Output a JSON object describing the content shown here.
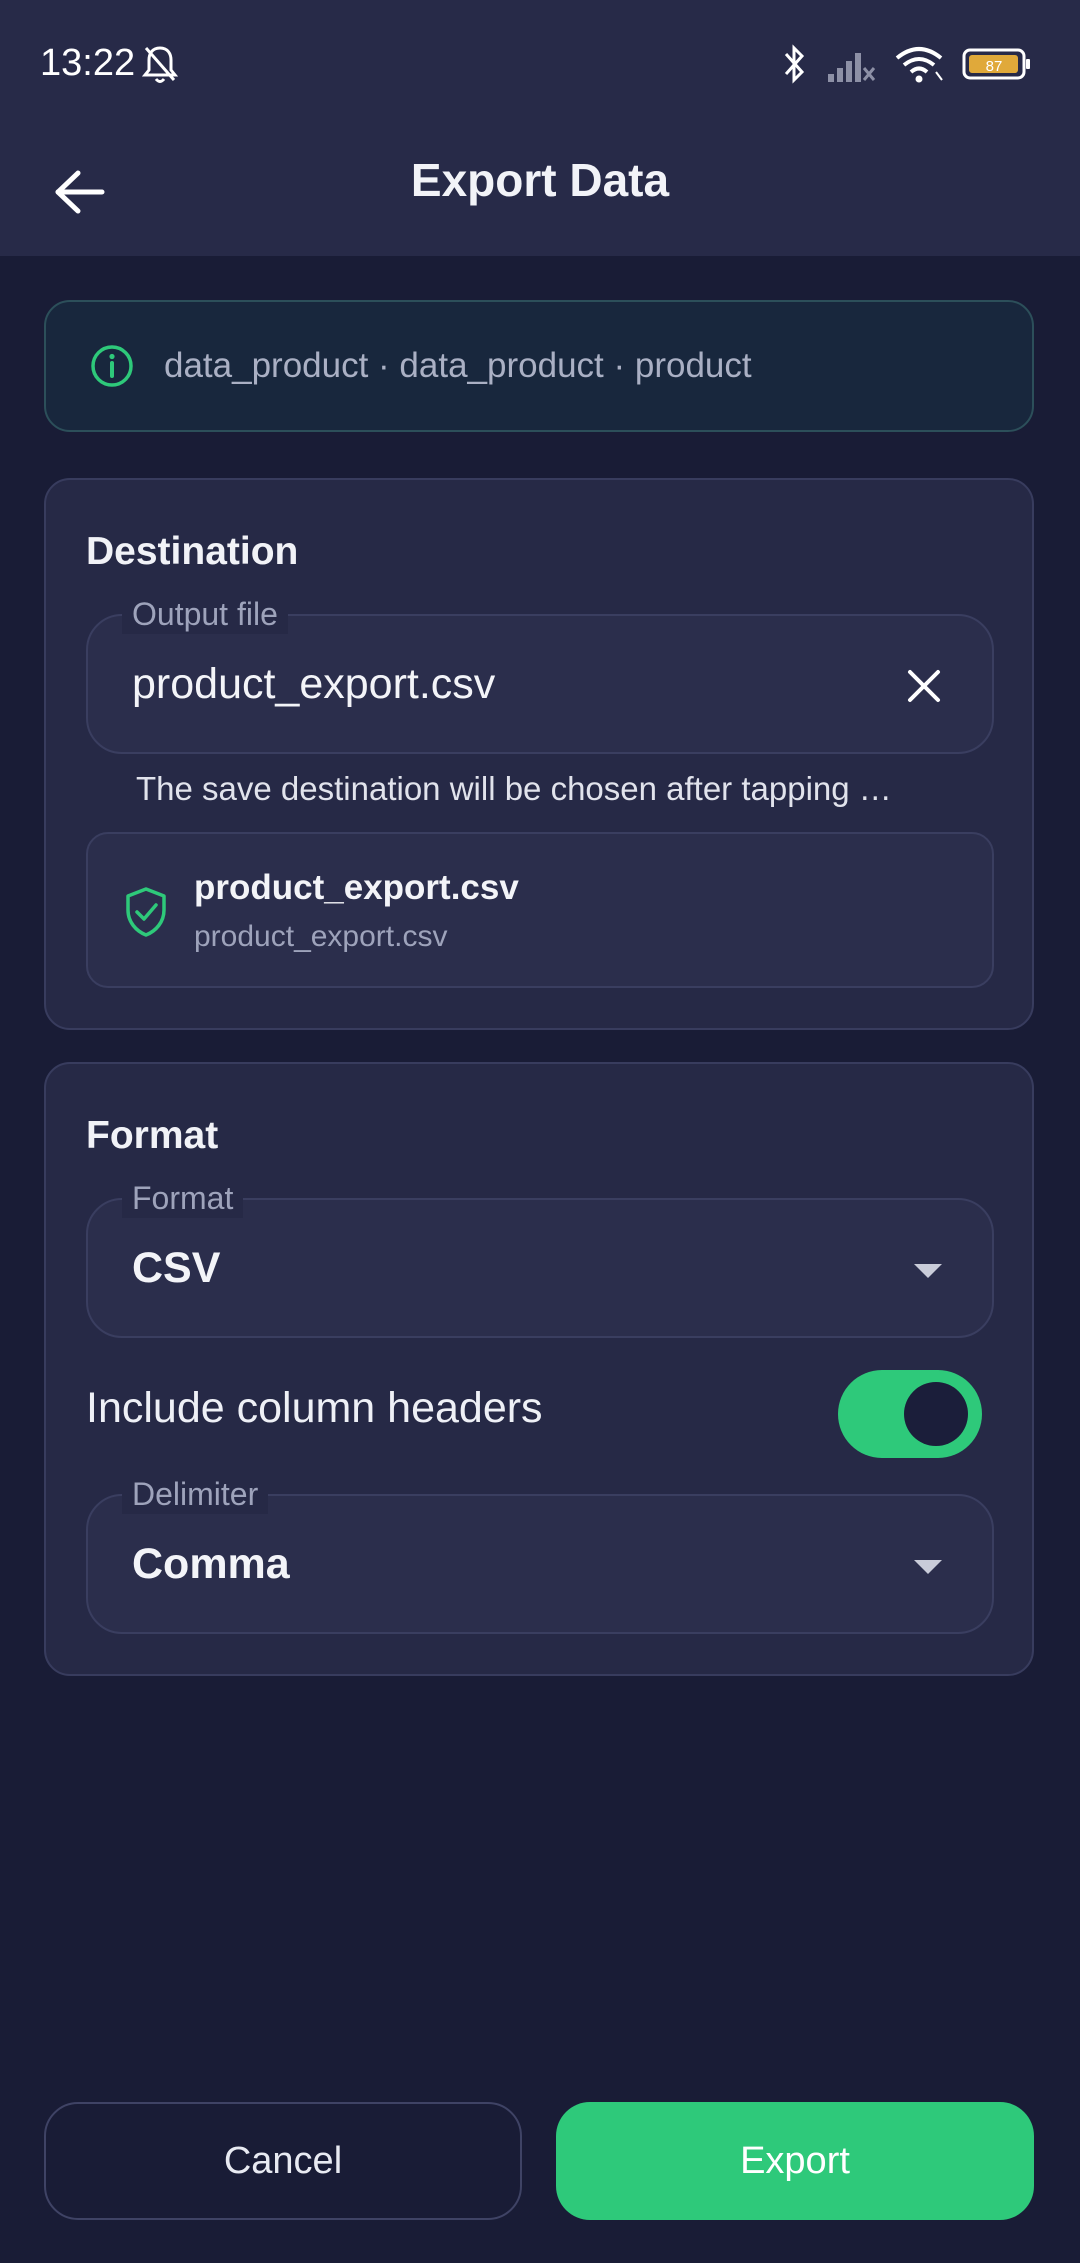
{
  "status_bar": {
    "time": "13:22",
    "battery": "87",
    "icons": [
      "bell-off-icon",
      "bluetooth-icon",
      "cell-signal-icon",
      "wifi-icon",
      "battery-icon"
    ]
  },
  "app_bar": {
    "title": "Export Data",
    "back_icon": "arrow-left-icon"
  },
  "info_banner": {
    "icon": "info-circle-icon",
    "text": "data_product · data_product · product"
  },
  "destination": {
    "title": "Destination",
    "output_file_label": "Output file",
    "output_file_value": "product_export.csv",
    "helper_text": "The save destination will be chosen after tapping …",
    "preview_name": "product_export.csv",
    "preview_path": "product_export.csv"
  },
  "format_section": {
    "title": "Format",
    "format_label": "Format",
    "format_value": "CSV",
    "include_headers_label": "Include column headers",
    "include_headers_on": true,
    "delimiter_label": "Delimiter",
    "delimiter_value": "Comma"
  },
  "actions": {
    "cancel_label": "Cancel",
    "export_label": "Export"
  },
  "colors": {
    "accent": "#2ec97a",
    "background": "#191c36",
    "surface": "#262946",
    "bar": "#272a48",
    "battery": "#e0a93a"
  }
}
